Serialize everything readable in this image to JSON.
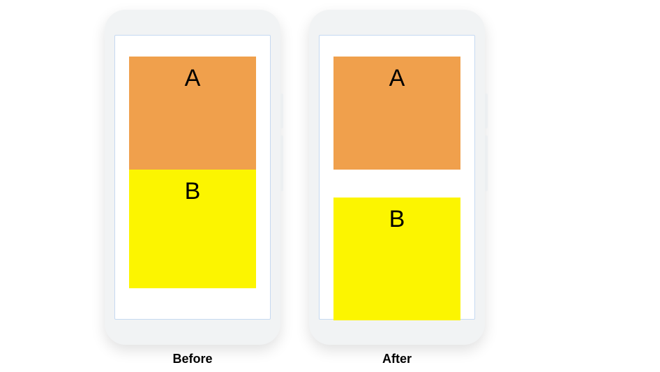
{
  "diagram": {
    "phones": {
      "before": {
        "caption": "Before",
        "blocks": {
          "a": "A",
          "b": "B"
        }
      },
      "after": {
        "caption": "After",
        "blocks": {
          "a": "A",
          "b": "B"
        }
      }
    },
    "colors": {
      "block_a": "#f0a04c",
      "block_b": "#fcf500",
      "screen_border": "#c5d9f1",
      "phone_body": "#f1f3f4"
    }
  }
}
